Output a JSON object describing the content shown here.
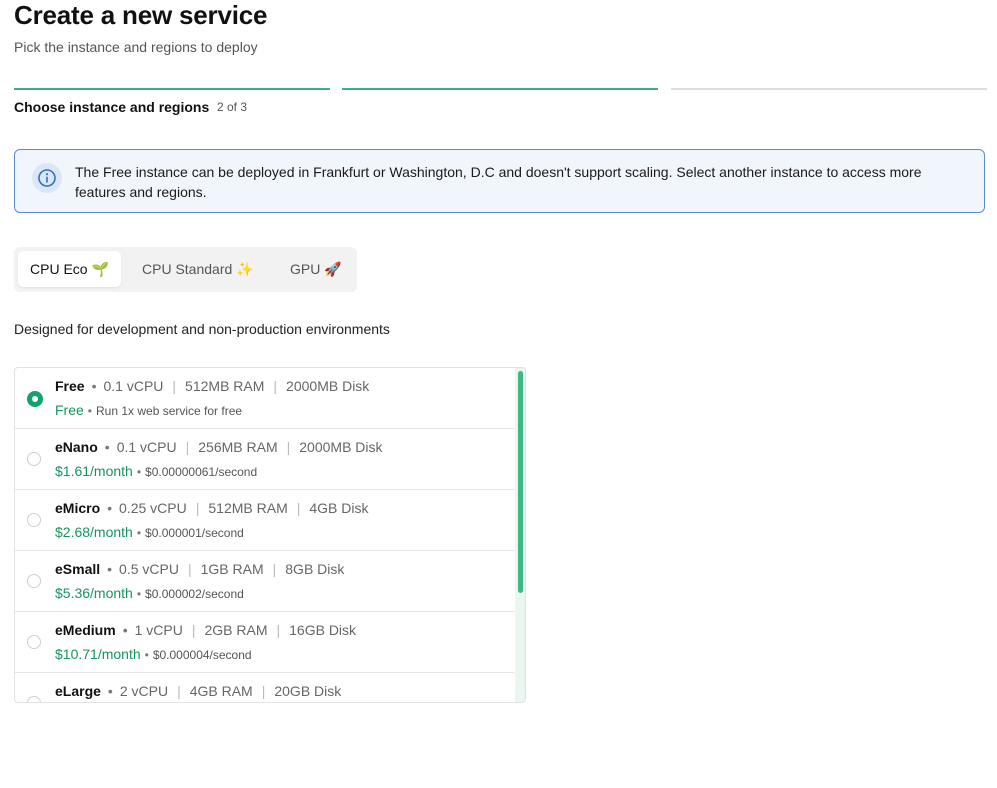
{
  "header": {
    "title": "Create a new service",
    "subtitle": "Pick the instance and regions to deploy"
  },
  "stepper": {
    "label": "Choose instance and regions",
    "count": "2 of 3",
    "steps": [
      {
        "state": "complete",
        "color": "#3fae84"
      },
      {
        "state": "current",
        "color": "#3fae84"
      },
      {
        "state": "upcoming",
        "color": "#dddddd"
      }
    ]
  },
  "alert": {
    "icon": "info-icon",
    "text": "The Free instance can be deployed in Frankfurt or Washington, D.C and doesn't support scaling. Select another instance to access more features and regions."
  },
  "tabs": [
    {
      "label": "CPU Eco 🌱",
      "active": true
    },
    {
      "label": "CPU Standard ✨",
      "active": false
    },
    {
      "label": "GPU 🚀",
      "active": false
    }
  ],
  "description": "Designed for development and non-production environments",
  "instances": [
    {
      "name": "Free",
      "vcpu": "0.1 vCPU",
      "ram": "512MB RAM",
      "disk": "2000MB Disk",
      "price": "Free",
      "extra": "Run 1x web service for free",
      "selected": true
    },
    {
      "name": "eNano",
      "vcpu": "0.1 vCPU",
      "ram": "256MB RAM",
      "disk": "2000MB Disk",
      "price": "$1.61/month",
      "extra": "$0.00000061/second",
      "selected": false
    },
    {
      "name": "eMicro",
      "vcpu": "0.25 vCPU",
      "ram": "512MB RAM",
      "disk": "4GB Disk",
      "price": "$2.68/month",
      "extra": "$0.000001/second",
      "selected": false
    },
    {
      "name": "eSmall",
      "vcpu": "0.5 vCPU",
      "ram": "1GB RAM",
      "disk": "8GB Disk",
      "price": "$5.36/month",
      "extra": "$0.000002/second",
      "selected": false
    },
    {
      "name": "eMedium",
      "vcpu": "1 vCPU",
      "ram": "2GB RAM",
      "disk": "16GB Disk",
      "price": "$10.71/month",
      "extra": "$0.000004/second",
      "selected": false
    },
    {
      "name": "eLarge",
      "vcpu": "2 vCPU",
      "ram": "4GB RAM",
      "disk": "20GB Disk",
      "price": "",
      "extra": "",
      "selected": false
    }
  ],
  "colors": {
    "accent": "#10a36a",
    "price": "#15965e",
    "alert_border": "#5b8ccf",
    "alert_bg": "#f1f6fc"
  }
}
